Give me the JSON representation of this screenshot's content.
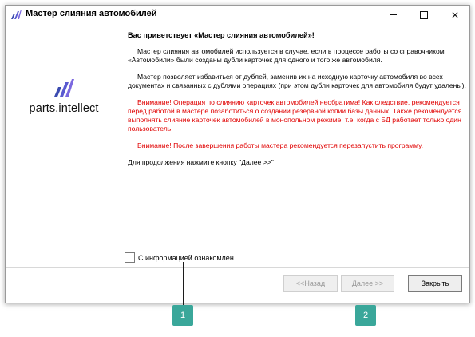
{
  "window": {
    "title": "Мастер слияния автомобилей",
    "controls": {
      "minimize": "—",
      "maximize": "☐",
      "close": "✕"
    }
  },
  "brand": {
    "name": "parts.intellect",
    "accent_color": "#3b4bb0",
    "accent_color_2": "#7b68e0"
  },
  "content": {
    "heading": "Вас приветствует «Мастер слияния автомобилей»!",
    "paragraph1": "Мастер слияния автомобилей используется в случае, если в процессе работы со справочником «Автомобили» были созданы дубли карточек для одного и того же автомобиля.",
    "paragraph2": "Мастер позволяет избавиться от дублей, заменив их на исходную карточку автомобиля во всех документах и связанных с дублями операциях (при этом дубли карточек для автомобиля будут удалены).",
    "warning1": "Внимание! Операция по слиянию карточек автомобилей необратима! Как следствие, рекомендуется перед работой в мастере позаботиться о создании резервной копии базы данных. Также рекомендуется выполнять слияние карточек автомобилей в монопольном режиме, т.е. когда с БД работает только один пользователь.",
    "warning2": "Внимание! После завершения работы мастера рекомендуется перезапустить программу.",
    "continue_hint": "Для продолжения нажмите кнопку \"Далее >>\""
  },
  "agreement": {
    "label": "С информацией ознакомлен",
    "checked": false
  },
  "buttons": {
    "back": "<<Назад",
    "next": "Далее >>",
    "close": "Закрыть"
  },
  "callouts": [
    "1",
    "2"
  ],
  "colors": {
    "warning_text": "#e00000",
    "callout_badge": "#3aa79a"
  }
}
